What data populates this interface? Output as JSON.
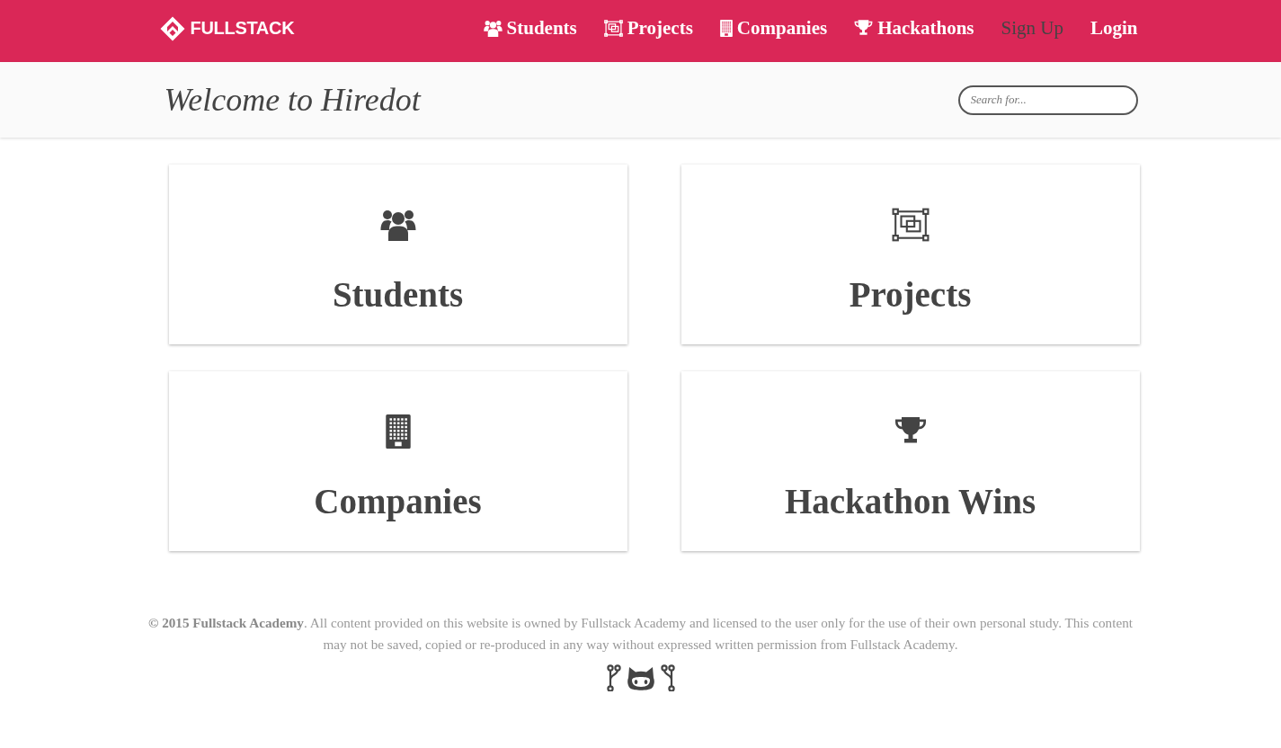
{
  "navbar": {
    "logo": "FULLSTACK",
    "links": [
      {
        "label": "Students",
        "selected": false
      },
      {
        "label": "Projects",
        "selected": false
      },
      {
        "label": "Companies",
        "selected": false
      },
      {
        "label": "Hackathons",
        "selected": false
      },
      {
        "label": "Sign Up",
        "selected": true
      },
      {
        "label": "Login",
        "selected": false
      }
    ]
  },
  "header": {
    "title": "Welcome to Hiredot",
    "search": {
      "placeholder": "Search for..."
    }
  },
  "cards": [
    {
      "title": "Students"
    },
    {
      "title": "Projects"
    },
    {
      "title": "Companies"
    },
    {
      "title": "Hackathon Wins"
    }
  ],
  "footer": {
    "notice": "**© 2015 Fullstack Academy**. All content provided on this website is owned by Fullstack Academy and licensed to the user only for the use of their own personal study. This content may not be saved, copied or re-produced in any way without expressed written permission from Fullstack Academy."
  }
}
